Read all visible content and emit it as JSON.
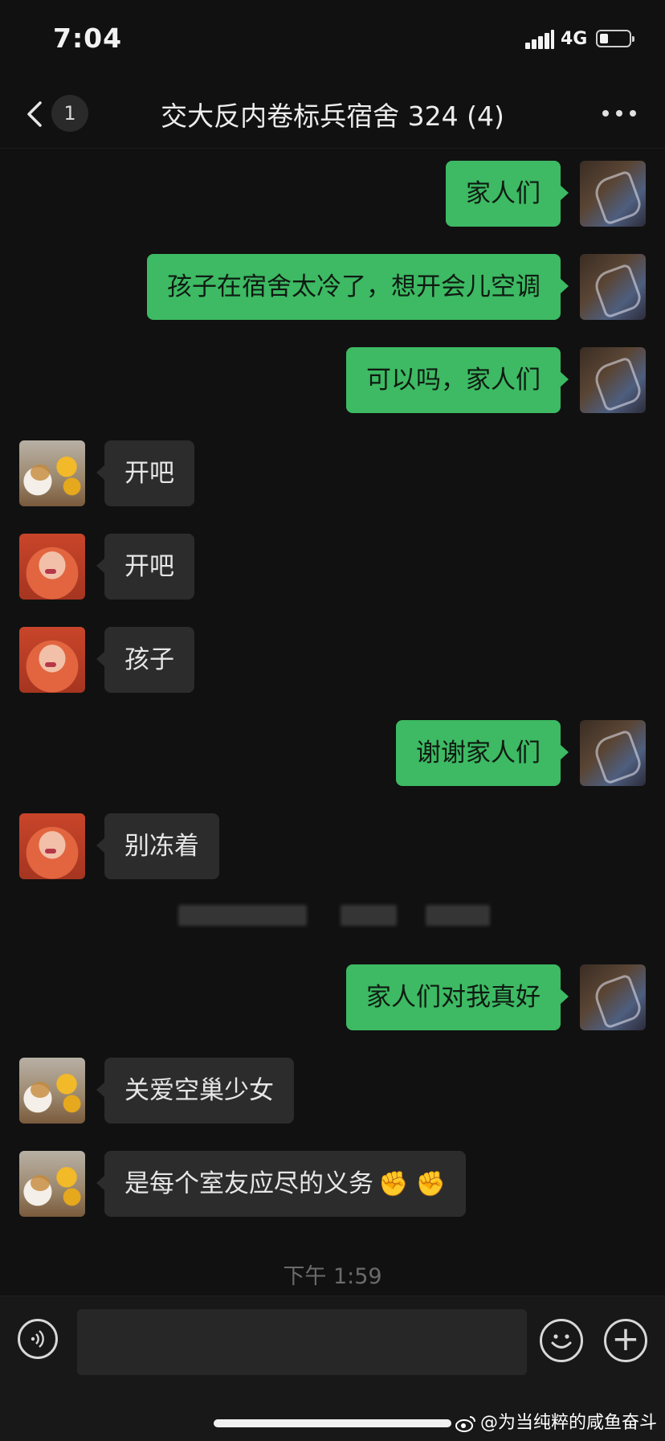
{
  "status_bar": {
    "time": "7:04",
    "network": "4G"
  },
  "nav": {
    "unread_count": "1",
    "title": "交大反内卷标兵宿舍 324 (4)"
  },
  "messages": [
    {
      "sender": "me",
      "avatar": "me",
      "text": "家人们"
    },
    {
      "sender": "me",
      "avatar": "me",
      "text": "孩子在宿舍太冷了，想开会儿空调"
    },
    {
      "sender": "me",
      "avatar": "me",
      "text": "可以吗，家人们"
    },
    {
      "sender": "them",
      "avatar": "cat",
      "text": "开吧"
    },
    {
      "sender": "them",
      "avatar": "girl",
      "text": "开吧"
    },
    {
      "sender": "them",
      "avatar": "girl",
      "text": "孩子"
    },
    {
      "sender": "me",
      "avatar": "me",
      "text": "谢谢家人们"
    },
    {
      "sender": "them",
      "avatar": "girl",
      "text": "别冻着"
    },
    {
      "sender": "me",
      "avatar": "me",
      "text": "家人们对我真好"
    },
    {
      "sender": "them",
      "avatar": "cat",
      "text": "关爱空巢少女"
    },
    {
      "sender": "them",
      "avatar": "cat",
      "text": "是每个室友应尽的义务",
      "emoji": "✊ ✊"
    }
  ],
  "timestamp": "下午 1:59",
  "watermark": "@为当纯粹的咸鱼奋斗",
  "colors": {
    "background": "#111111",
    "my_bubble": "#3dba63",
    "their_bubble": "#2c2c2c"
  }
}
